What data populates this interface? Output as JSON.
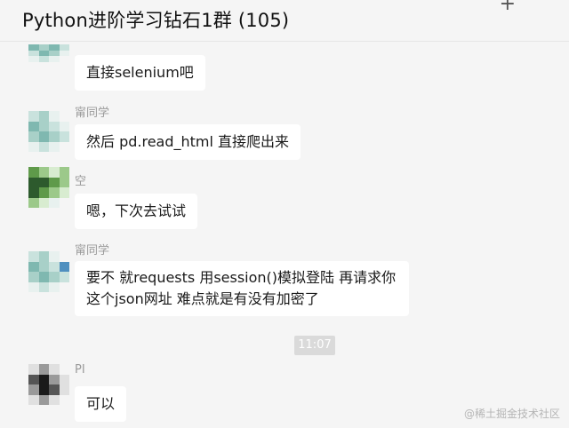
{
  "header": {
    "title": "Python进阶学习钻石1群 (105)",
    "add_icon": "+"
  },
  "messages": [
    {
      "sender": "",
      "text": "直接selenium吧",
      "avatar_colors": [
        "#7fb8b0",
        "#a8d0c8",
        "#c9e2dd",
        "#e8f1ef"
      ]
    },
    {
      "sender": "甯同学",
      "text": "然后 pd.read_html 直接爬出来",
      "avatar_colors": [
        "#7fb8b0",
        "#a8d0c8",
        "#c9e2dd",
        "#e8f1ef"
      ]
    },
    {
      "sender": "空",
      "text": "嗯，下次去试试",
      "avatar_colors": [
        "#2d5a2d",
        "#5f9a4a",
        "#9cc98a",
        "#d8ecd0"
      ]
    },
    {
      "sender": "甯同学",
      "text": "要不 就requests  用session()模拟登陆 再请求你这个json网址 难点就是有没有加密了",
      "avatar_colors": [
        "#7fb8b0",
        "#a8d0c8",
        "#c9e2dd",
        "#e8f1ef"
      ]
    },
    {
      "sender": "PI",
      "text": "可以",
      "avatar_colors": [
        "#1a1a1a",
        "#555555",
        "#9a9a9a",
        "#e0e0e0"
      ]
    }
  ],
  "timestamp": "11:07",
  "watermark": "@稀土掘金技术社区"
}
